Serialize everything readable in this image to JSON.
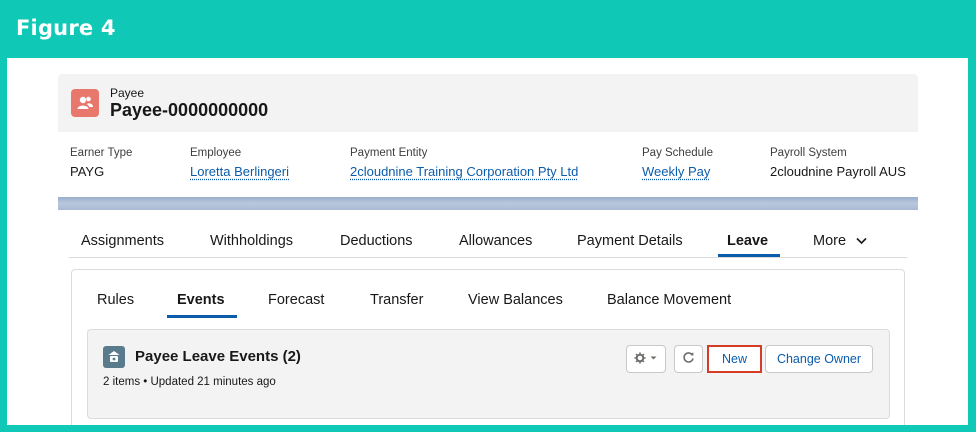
{
  "figure": {
    "title": "Figure 4"
  },
  "record": {
    "object_label": "Payee",
    "name": "Payee-0000000000",
    "icon": "payee-contact-icon",
    "icon_color": "#e8786c"
  },
  "highlights": [
    {
      "label": "Earner Type",
      "value": "PAYG",
      "link": false
    },
    {
      "label": "Employee",
      "value": "Loretta Berlingeri",
      "link": true
    },
    {
      "label": "Payment Entity",
      "value": "2cloudnine Training Corporation Pty Ltd",
      "link": true
    },
    {
      "label": "Pay Schedule",
      "value": "Weekly Pay",
      "link": true
    },
    {
      "label": "Payroll System",
      "value": "2cloudnine Payroll AUS",
      "link": false
    }
  ],
  "main_tabs": [
    {
      "label": "Assignments"
    },
    {
      "label": "Withholdings"
    },
    {
      "label": "Deductions"
    },
    {
      "label": "Allowances"
    },
    {
      "label": "Payment Details"
    },
    {
      "label": "Leave",
      "active": true
    },
    {
      "label": "More"
    }
  ],
  "sub_tabs": [
    {
      "label": "Rules"
    },
    {
      "label": "Events",
      "active": true
    },
    {
      "label": "Forecast"
    },
    {
      "label": "Transfer"
    },
    {
      "label": "View Balances"
    },
    {
      "label": "Balance Movement"
    }
  ],
  "related_list": {
    "title": "Payee Leave Events (2)",
    "meta": "2 items • Updated 21 minutes ago",
    "icon": "leave-events-icon",
    "buttons": {
      "actions_icon": "gear-icon",
      "refresh_icon": "refresh-icon",
      "new_label": "New",
      "change_owner_label": "Change Owner"
    }
  },
  "colors": {
    "frame": "#0fc9b6",
    "link": "#0b5cab",
    "highlight_border": "#d63b26"
  }
}
